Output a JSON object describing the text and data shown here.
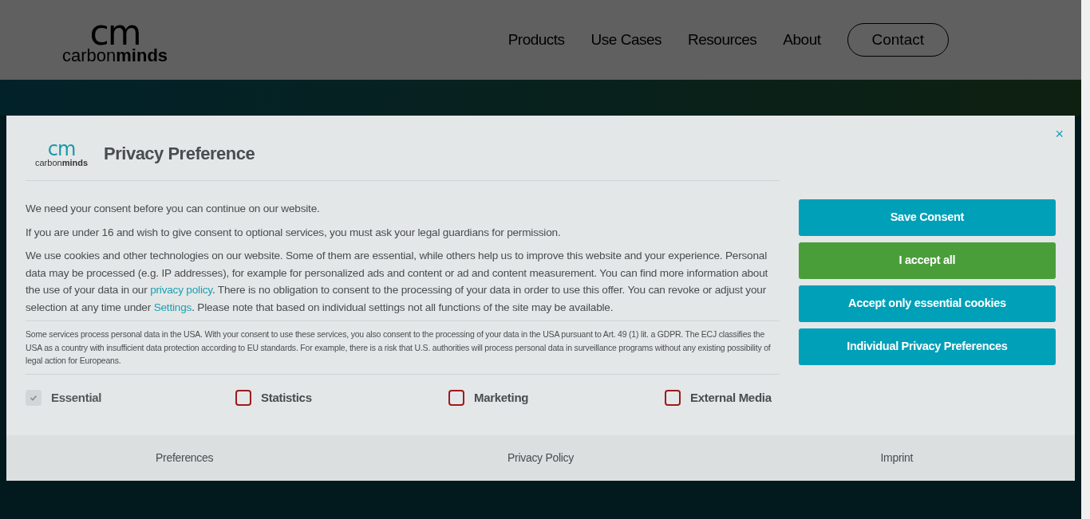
{
  "site_header": {
    "logo": {
      "mark": "cm",
      "wordmark": "carbon**minds**"
    },
    "nav": [
      {
        "label": "Products",
        "kind": "link"
      },
      {
        "label": "Use Cases",
        "kind": "link"
      },
      {
        "label": "Resources",
        "kind": "link"
      },
      {
        "label": "About",
        "kind": "link"
      },
      {
        "label": "Contact",
        "kind": "pill"
      }
    ]
  },
  "dialog": {
    "logo": {
      "mark": "cm",
      "wordmark": "carbon**minds**"
    },
    "title": "Privacy Preference",
    "close": "×",
    "paragraphs": [
      [
        {
          "kind": "text",
          "text": "We need your consent before you can continue on our website."
        }
      ],
      [
        {
          "kind": "text",
          "text": "If you are under 16 and wish to give consent to optional services, you must ask your legal guardians for permission."
        }
      ],
      [
        {
          "kind": "text",
          "text": "We use cookies and other technologies on our website. Some of them are essential, while others help us to improve this website and your experience. Personal data may be processed (e.g. IP addresses), for example for personalized ads and content or ad and content measurement. You can find more information about the use of your data in our "
        },
        {
          "kind": "link",
          "text": "privacy policy"
        },
        {
          "kind": "text",
          "text": ". There is no obligation to consent to the processing of your data in order to use this offer. You can revoke or adjust your selection at any time under "
        },
        {
          "kind": "link",
          "text": "Settings"
        },
        {
          "kind": "text",
          "text": ". Please note that based on individual settings not all functions of the site may be available."
        }
      ]
    ],
    "usa_notice": "Some services process personal data in the USA. With your consent to use these services, you also consent to the processing of your data in the USA pursuant to Art. 49 (1) lit. a GDPR. The ECJ classifies the USA as a country with insufficient data protection according to EU standards. For example, there is a risk that U.S. authorities will process personal data in surveillance programs without any existing possibility of legal action for Europeans.",
    "categories": [
      {
        "label": "Essential",
        "checked": true,
        "disabled": true
      },
      {
        "label": "Statistics",
        "checked": false,
        "disabled": false
      },
      {
        "label": "Marketing",
        "checked": false,
        "disabled": false
      },
      {
        "label": "External Media",
        "checked": false,
        "disabled": false
      }
    ],
    "buttons": [
      {
        "label": "Save Consent",
        "kind": "secondary"
      },
      {
        "label": "I accept all",
        "kind": "primary"
      },
      {
        "label": "Accept only essential cookies",
        "kind": "secondary"
      },
      {
        "label": "Individual Privacy Preferences",
        "kind": "secondary"
      }
    ],
    "footer_links": [
      "Preferences",
      "Privacy Policy",
      "Imprint"
    ]
  }
}
